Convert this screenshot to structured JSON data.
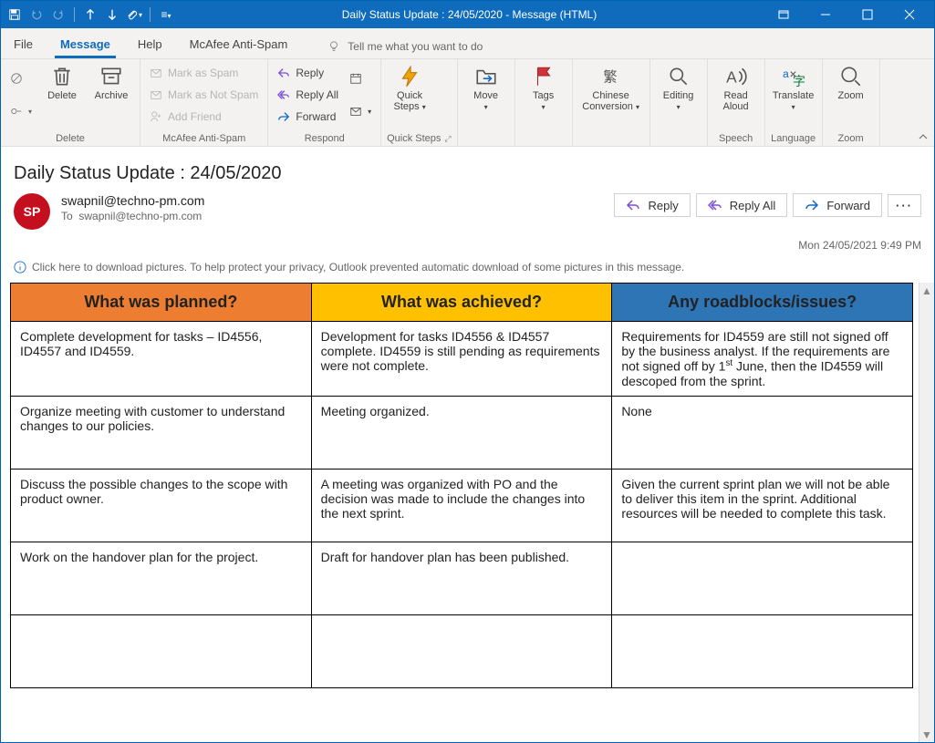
{
  "window_title": "Daily Status Update : 24/05/2020  -  Message (HTML)",
  "tabs": {
    "file": "File",
    "message": "Message",
    "help": "Help",
    "mcafee": "McAfee Anti-Spam"
  },
  "tellme_placeholder": "Tell me what you want to do",
  "ribbon": {
    "delete_group": {
      "delete": "Delete",
      "archive": "Archive",
      "label": "Delete"
    },
    "mcafee": {
      "mark_spam": "Mark as Spam",
      "mark_not_spam": "Mark as Not Spam",
      "add_friend": "Add Friend",
      "label": "McAfee Anti-Spam"
    },
    "respond": {
      "reply": "Reply",
      "reply_all": "Reply All",
      "forward": "Forward",
      "label": "Respond"
    },
    "quicksteps": {
      "btn": "Quick Steps",
      "label": "Quick Steps"
    },
    "move": {
      "btn": "Move",
      "label": ""
    },
    "tags": {
      "btn": "Tags",
      "label": ""
    },
    "chinese": {
      "btn": "Chinese Conversion",
      "label": ""
    },
    "editing": {
      "btn": "Editing",
      "label": ""
    },
    "speech": {
      "btn": "Read Aloud",
      "label": "Speech"
    },
    "language": {
      "btn": "Translate",
      "label": "Language"
    },
    "zoom": {
      "btn": "Zoom",
      "label": "Zoom"
    }
  },
  "subject": "Daily Status Update : 24/05/2020",
  "avatar_initials": "SP",
  "from": "swapnil@techno-pm.com",
  "to_prefix": "To",
  "to": "swapnil@techno-pm.com",
  "hdr_actions": {
    "reply": "Reply",
    "reply_all": "Reply All",
    "forward": "Forward"
  },
  "received": "Mon 24/05/2021 9:49 PM",
  "infobar": "Click here to download pictures. To help protect your privacy, Outlook prevented automatic download of some pictures in this message.",
  "table": {
    "headers": {
      "planned": "What was planned?",
      "achieved": "What was achieved?",
      "issues": "Any roadblocks/issues?"
    },
    "rows": [
      {
        "planned": "Complete development for tasks – ID4556, ID4557 and ID4559.",
        "achieved": "Development for tasks ID4556 & ID4557 complete. ID4559 is still pending as requirements were not complete.",
        "issues_html": "Requirements for ID4559 are still not signed off by the business analyst. If the requirements are not signed off by 1<sup>st</sup> June, then the ID4559 will descoped from the sprint."
      },
      {
        "planned": "Organize meeting with customer to understand changes to our policies.",
        "achieved": "Meeting organized.",
        "issues": "None"
      },
      {
        "planned": "Discuss the possible changes to the scope with product owner.",
        "achieved": "A meeting was organized with PO and the decision was made to include the changes into the next sprint.",
        "issues": "Given the current sprint plan we will not be able to deliver this item in the sprint. Additional resources will be needed to complete this task."
      },
      {
        "planned": "Work on the handover plan for the project.",
        "achieved": "Draft for handover plan has been published.",
        "issues": ""
      },
      {
        "planned": "",
        "achieved": "",
        "issues": ""
      }
    ]
  }
}
